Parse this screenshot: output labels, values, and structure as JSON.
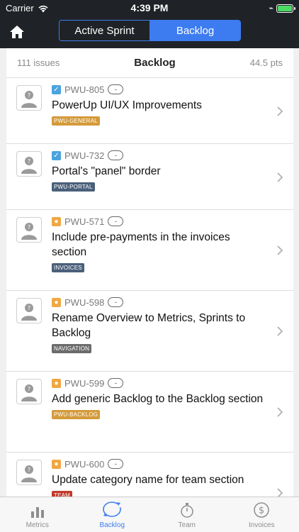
{
  "status_bar": {
    "carrier": "Carrier",
    "time": "4:39 PM"
  },
  "header": {
    "segments": [
      {
        "label": "Active Sprint",
        "active": false
      },
      {
        "label": "Backlog",
        "active": true
      }
    ],
    "accent_color": "#3d7cf0"
  },
  "list": {
    "issue_count": "111 issues",
    "title": "Backlog",
    "points": "44.5 pts",
    "issues": [
      {
        "key": "PWU-805",
        "type": "task",
        "points": "-",
        "title": "PowerUp UI/UX Improvements",
        "label": "PWU-GENERAL",
        "label_color": "#d49a3a"
      },
      {
        "key": "PWU-732",
        "type": "task",
        "points": "-",
        "title": "Portal's \"panel\" border",
        "label": "PWU-PORTAL",
        "label_color": "#4a5f7a"
      },
      {
        "key": "PWU-571",
        "type": "story",
        "points": "-",
        "title": "Include pre-payments in the invoices section",
        "label": "INVOICES",
        "label_color": "#4a5f7a"
      },
      {
        "key": "PWU-598",
        "type": "story",
        "points": "-",
        "title": "Rename Overview to Metrics, Sprints to Backlog",
        "label": "NAVIGATION",
        "label_color": "#6b6b6b"
      },
      {
        "key": "PWU-599",
        "type": "story",
        "points": "-",
        "title": "Add generic Backlog to the Backlog section",
        "label": "PWU-BACKLOG",
        "label_color": "#d49a3a"
      },
      {
        "key": "PWU-600",
        "type": "story",
        "points": "-",
        "title": "Update category name for team section",
        "label": "TEAM",
        "label_color": "#c0392b"
      }
    ]
  },
  "tabbar": {
    "tabs": [
      {
        "label": "Metrics",
        "icon": "bar-chart-icon",
        "active": false
      },
      {
        "label": "Backlog",
        "icon": "refresh-cycle-icon",
        "active": true
      },
      {
        "label": "Team",
        "icon": "stopwatch-icon",
        "active": false
      },
      {
        "label": "Invoices",
        "icon": "dollar-icon",
        "active": false
      }
    ]
  }
}
